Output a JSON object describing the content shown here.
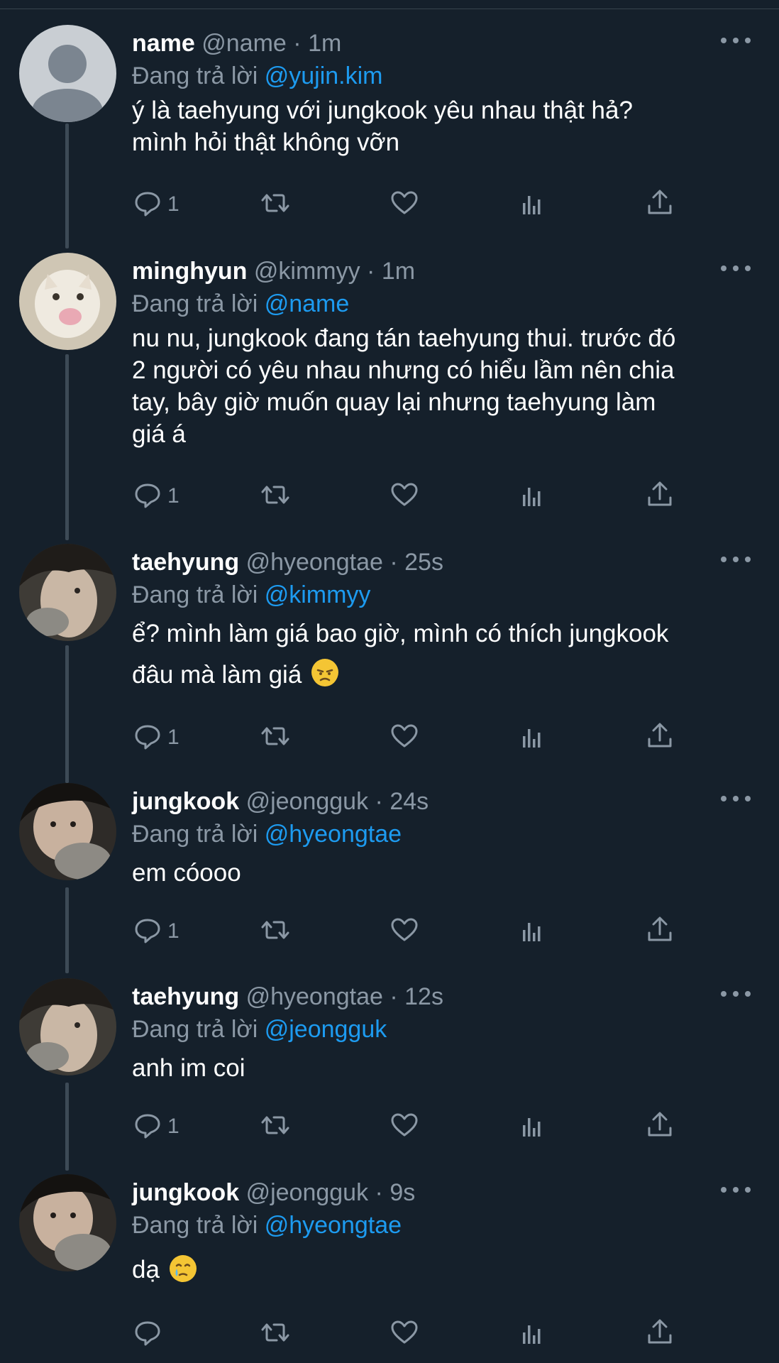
{
  "colors": {
    "background": "#15202b",
    "text": "#ffffff",
    "muted": "#8b98a5",
    "link": "#1d9bf0",
    "thread_line": "#3d4a56"
  },
  "reply_prefix": "Đang trả lời",
  "tweets": [
    {
      "display_name": "name",
      "handle": "@name",
      "time": "1m",
      "replying_to": "@yujin.kim",
      "text_lines": [
        "ý là taehyung với jungkook yêu nhau thật hả?",
        "mình hỏi thật không vỡn"
      ],
      "reply_count": "1",
      "avatar": "default-avatar"
    },
    {
      "display_name": "minghyun",
      "handle": "@kimmyy",
      "time": "1m",
      "replying_to": "@name",
      "text_lines": [
        "nu nu, jungkook đang tán taehyung thui. trước đó",
        "2 người có yêu nhau nhưng có hiểu lầm nên chia",
        "tay, bây giờ muốn quay lại nhưng taehyung làm",
        "giá á"
      ],
      "reply_count": "1",
      "avatar": "cat-avatar"
    },
    {
      "display_name": "taehyung",
      "handle": "@hyeongtae",
      "time": "25s",
      "replying_to": "@kimmyy",
      "text_lines": [
        "ể? mình làm giá bao giờ, mình có thích jungkook",
        "đâu mà làm giá"
      ],
      "emoji": "unamused-face-emoji",
      "reply_count": "1",
      "avatar": "photo-avatar-taehyung"
    },
    {
      "display_name": "jungkook",
      "handle": "@jeongguk",
      "time": "24s",
      "replying_to": "@hyeongtae",
      "text_lines": [
        "em cóooo"
      ],
      "reply_count": "1",
      "avatar": "photo-avatar-jungkook"
    },
    {
      "display_name": "taehyung",
      "handle": "@hyeongtae",
      "time": "12s",
      "replying_to": "@jeongguk",
      "text_lines": [
        "anh im coi"
      ],
      "reply_count": "1",
      "avatar": "photo-avatar-taehyung"
    },
    {
      "display_name": "jungkook",
      "handle": "@jeongguk",
      "time": "9s",
      "replying_to": "@hyeongtae",
      "text_lines": [
        "dạ"
      ],
      "emoji": "crying-face-emoji",
      "reply_count": "",
      "avatar": "photo-avatar-jungkook"
    }
  ],
  "action_icons": [
    "reply-icon",
    "retweet-icon",
    "like-icon",
    "views-icon",
    "share-icon"
  ]
}
